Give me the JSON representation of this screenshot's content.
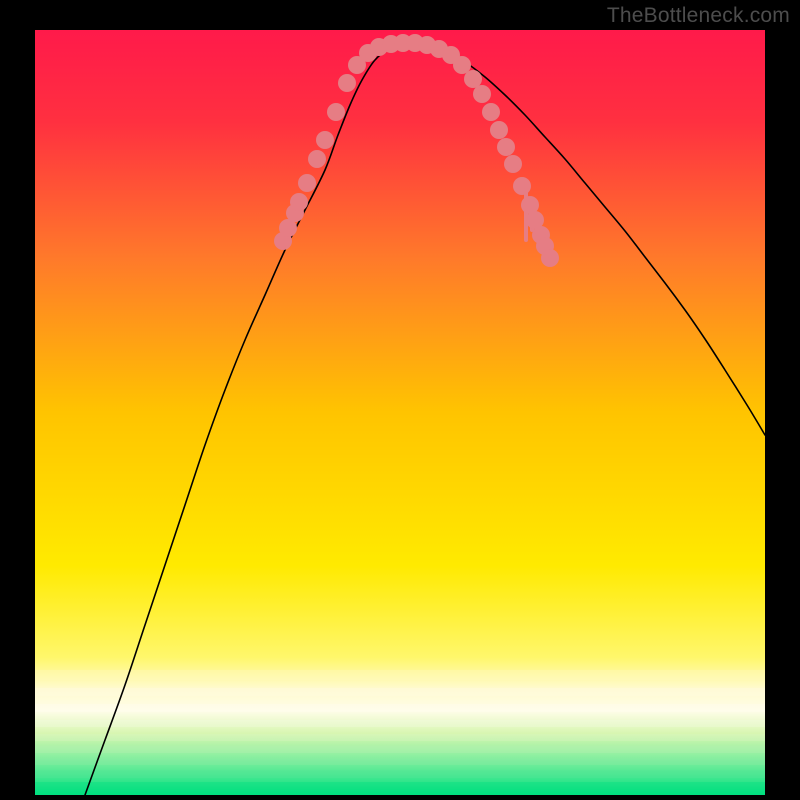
{
  "watermark": "TheBottleneck.com",
  "chart_data": {
    "type": "line",
    "title": "",
    "xlabel": "",
    "ylabel": "",
    "xlim": [
      0,
      730
    ],
    "ylim": [
      0,
      765
    ],
    "background_gradient": {
      "top": "#ff1a4a",
      "mid": "#ffe600",
      "bottom": "#00e080"
    },
    "series": [
      {
        "name": "curve",
        "color": "#000000",
        "x": [
          50,
          70,
          90,
          110,
          130,
          150,
          170,
          190,
          210,
          230,
          250,
          270,
          290,
          303,
          315,
          327,
          340,
          355,
          370,
          380,
          395,
          410,
          430,
          450,
          470,
          490,
          510,
          530,
          550,
          570,
          590,
          610,
          630,
          650,
          670,
          690,
          712,
          730
        ],
        "y": [
          0,
          55,
          110,
          170,
          230,
          290,
          350,
          405,
          455,
          500,
          545,
          585,
          625,
          660,
          690,
          715,
          735,
          747,
          752,
          752,
          750,
          744,
          733,
          718,
          700,
          680,
          658,
          636,
          612,
          588,
          564,
          538,
          512,
          485,
          456,
          425,
          390,
          360
        ]
      }
    ],
    "markers": {
      "name": "dots",
      "color": "#e67d84",
      "radius": 9,
      "points": [
        {
          "x": 248,
          "y": 554
        },
        {
          "x": 253,
          "y": 567
        },
        {
          "x": 260,
          "y": 582
        },
        {
          "x": 264,
          "y": 593
        },
        {
          "x": 272,
          "y": 612
        },
        {
          "x": 282,
          "y": 636
        },
        {
          "x": 290,
          "y": 655
        },
        {
          "x": 301,
          "y": 683
        },
        {
          "x": 312,
          "y": 712
        },
        {
          "x": 322,
          "y": 730
        },
        {
          "x": 333,
          "y": 742
        },
        {
          "x": 344,
          "y": 748
        },
        {
          "x": 356,
          "y": 751
        },
        {
          "x": 368,
          "y": 752
        },
        {
          "x": 380,
          "y": 752
        },
        {
          "x": 392,
          "y": 750
        },
        {
          "x": 404,
          "y": 746
        },
        {
          "x": 416,
          "y": 740
        },
        {
          "x": 427,
          "y": 730
        },
        {
          "x": 438,
          "y": 716
        },
        {
          "x": 447,
          "y": 701
        },
        {
          "x": 456,
          "y": 683
        },
        {
          "x": 464,
          "y": 665
        },
        {
          "x": 471,
          "y": 648
        },
        {
          "x": 478,
          "y": 631
        },
        {
          "x": 487,
          "y": 609
        },
        {
          "x": 495,
          "y": 590
        },
        {
          "x": 500,
          "y": 575
        },
        {
          "x": 506,
          "y": 560
        },
        {
          "x": 510,
          "y": 549
        },
        {
          "x": 515,
          "y": 537
        }
      ]
    },
    "tick_color": "#e67d84",
    "tick_spikes": [
      {
        "x": 491,
        "y1": 555,
        "y2": 602
      },
      {
        "x": 497,
        "y1": 565,
        "y2": 590
      }
    ]
  }
}
